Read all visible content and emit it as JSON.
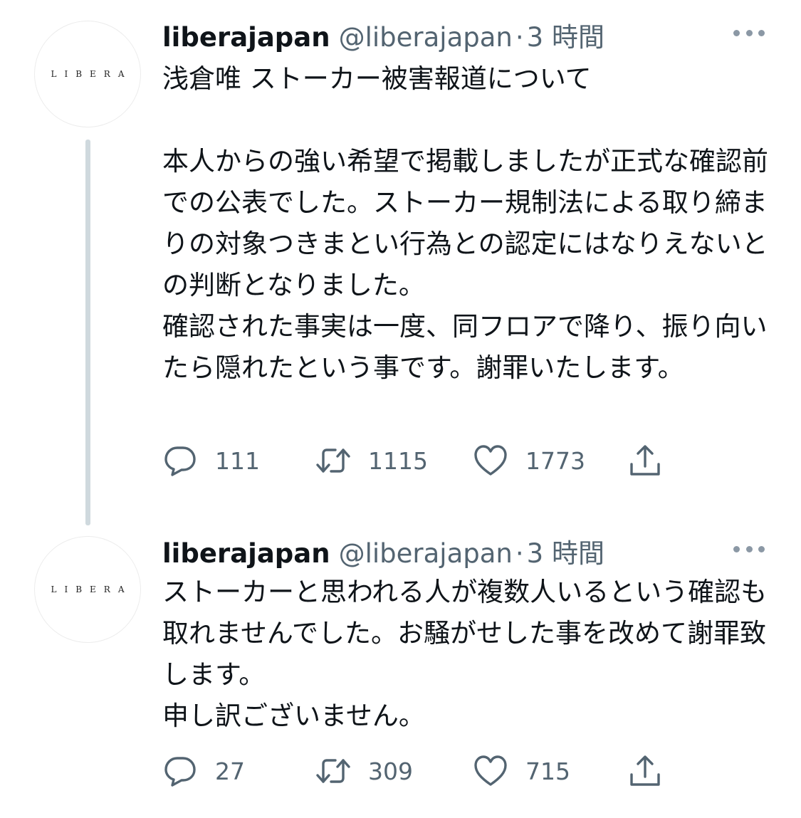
{
  "tweets": [
    {
      "avatar_text": "LIBERA",
      "display_name": "liberajapan",
      "handle": "@liberajapan",
      "separator": "·",
      "time": "3 時間",
      "text": "浅倉唯 ストーカー被害報道について\n\n本人からの強い希望で掲載しましたが正式な確認前での公表でした。ストーカー規制法による取り締まりの対象つきまとい行為との認定にはなりえないとの判断となりました。\n確認された事実は一度、同フロアで降り、振り向いたら隠れたという事です。謝罪いたします。",
      "replies": "111",
      "retweets": "1115",
      "likes": "1773"
    },
    {
      "avatar_text": "LIBERA",
      "display_name": "liberajapan",
      "handle": "@liberajapan",
      "separator": "·",
      "time": "3 時間",
      "text": "ストーカーと思われる人が複数人いるという確認も取れませんでした。お騒がせした事を改めて謝罪致します。\n申し訳ございません。",
      "replies": "27",
      "retweets": "309",
      "likes": "715"
    }
  ],
  "icons": {
    "reply": "reply-icon",
    "retweet": "retweet-icon",
    "like": "heart-icon",
    "share": "share-icon",
    "more": "more-icon"
  },
  "colors": {
    "text": "#0f1419",
    "secondary": "#536471",
    "thread_line": "#cfd9de"
  }
}
